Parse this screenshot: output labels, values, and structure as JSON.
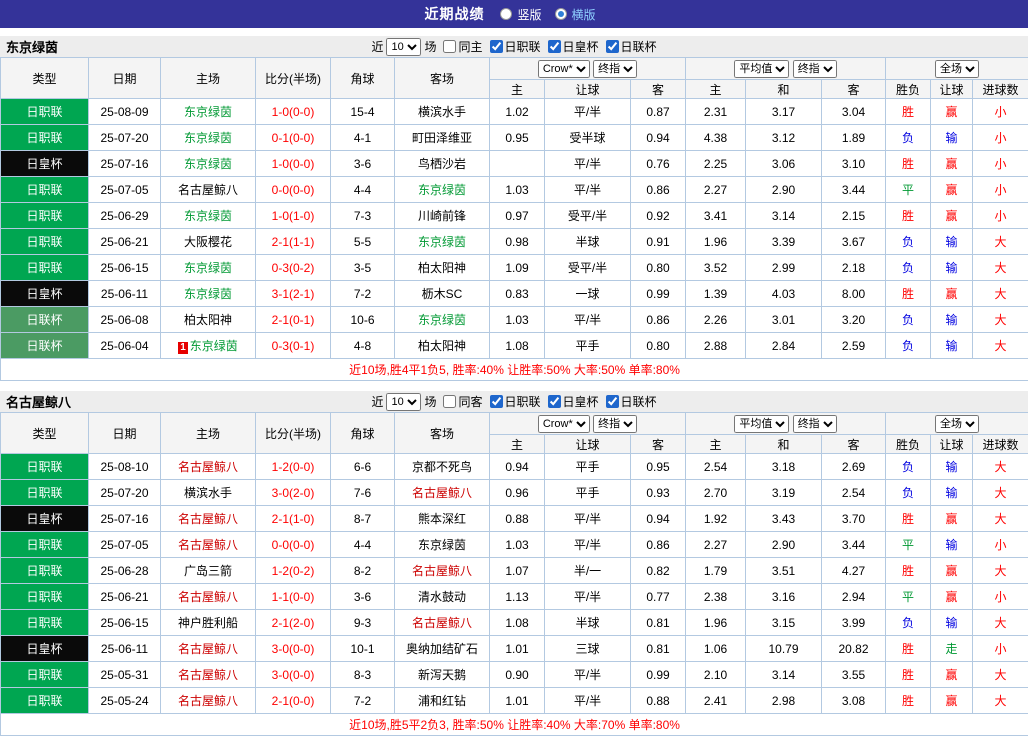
{
  "topbar": {
    "title": "近期战绩",
    "radio_vertical": "竖版",
    "radio_horizontal": "横版"
  },
  "controls": {
    "near_label": "近",
    "games_count": "10",
    "games_label": "场",
    "leagues": [
      "日职联",
      "日皇杯",
      "日联杯"
    ]
  },
  "header_selects": {
    "bookmaker": "Crow*",
    "final_odds": "终指",
    "average": "平均值",
    "final_odds2": "终指",
    "fulltime": "全场"
  },
  "table_headers": {
    "type": "类型",
    "date": "日期",
    "home": "主场",
    "score": "比分(半场)",
    "corners": "角球",
    "away": "客场",
    "odds_home": "主",
    "odds_line": "让球",
    "odds_away": "客",
    "euro_home": "主",
    "euro_draw": "和",
    "euro_away": "客",
    "result_outcome": "胜负",
    "result_handicap": "让球",
    "result_goals": "进球数"
  },
  "type_colors": {
    "日职联": "#00A651",
    "日皇杯": "#0A0A0A",
    "日联杯": "#4B9B63"
  },
  "result_colors": {
    "胜": "#FF0000",
    "平": "#009933",
    "负": "#0000E0",
    "赢": "#FF0000",
    "输": "#0000E0",
    "走": "#009933",
    "大": "#FF0000",
    "小": "#FF0000"
  },
  "sections": [
    {
      "team": "东京绿茵",
      "team_color": "#009933",
      "same_label": "同主",
      "summary": "近10场,胜4平1负5, 胜率:40% 让胜率:50% 大率:50% 单率:80%",
      "rows": [
        {
          "type": "日职联",
          "date": "25-08-09",
          "home": "东京绿茵",
          "hf": true,
          "score": "1-0(0-0)",
          "corners": "15-4",
          "away": "横滨水手",
          "af": false,
          "o1": "1.02",
          "hcp": "平/半",
          "o2": "0.87",
          "e1": "2.31",
          "e2": "3.17",
          "e3": "3.04",
          "r1": "胜",
          "r2": "赢",
          "r3": "小"
        },
        {
          "type": "日职联",
          "date": "25-07-20",
          "home": "东京绿茵",
          "hf": true,
          "score": "0-1(0-0)",
          "corners": "4-1",
          "away": "町田泽维亚",
          "af": false,
          "o1": "0.95",
          "hcp": "受半球",
          "o2": "0.94",
          "e1": "4.38",
          "e2": "3.12",
          "e3": "1.89",
          "r1": "负",
          "r2": "输",
          "r3": "小"
        },
        {
          "type": "日皇杯",
          "date": "25-07-16",
          "home": "东京绿茵",
          "hf": true,
          "score": "1-0(0-0)",
          "corners": "3-6",
          "away": "鸟栖沙岩",
          "af": false,
          "o1": "",
          "hcp": "平/半",
          "o2": "0.76",
          "e1": "2.25",
          "e2": "3.06",
          "e3": "3.10",
          "r1": "胜",
          "r2": "赢",
          "r3": "小"
        },
        {
          "type": "日职联",
          "date": "25-07-05",
          "home": "名古屋鲸八",
          "hf": false,
          "score": "0-0(0-0)",
          "corners": "4-4",
          "away": "东京绿茵",
          "af": true,
          "o1": "1.03",
          "hcp": "平/半",
          "o2": "0.86",
          "e1": "2.27",
          "e2": "2.90",
          "e3": "3.44",
          "r1": "平",
          "r2": "赢",
          "r3": "小"
        },
        {
          "type": "日职联",
          "date": "25-06-29",
          "home": "东京绿茵",
          "hf": true,
          "score": "1-0(1-0)",
          "corners": "7-3",
          "away": "川崎前锋",
          "af": false,
          "o1": "0.97",
          "hcp": "受平/半",
          "o2": "0.92",
          "e1": "3.41",
          "e2": "3.14",
          "e3": "2.15",
          "r1": "胜",
          "r2": "赢",
          "r3": "小"
        },
        {
          "type": "日职联",
          "date": "25-06-21",
          "home": "大阪樱花",
          "hf": false,
          "score": "2-1(1-1)",
          "corners": "5-5",
          "away": "东京绿茵",
          "af": true,
          "o1": "0.98",
          "hcp": "半球",
          "o2": "0.91",
          "e1": "1.96",
          "e2": "3.39",
          "e3": "3.67",
          "r1": "负",
          "r2": "输",
          "r3": "大"
        },
        {
          "type": "日职联",
          "date": "25-06-15",
          "home": "东京绿茵",
          "hf": true,
          "score": "0-3(0-2)",
          "corners": "3-5",
          "away": "柏太阳神",
          "af": false,
          "o1": "1.09",
          "hcp": "受平/半",
          "o2": "0.80",
          "e1": "3.52",
          "e2": "2.99",
          "e3": "2.18",
          "r1": "负",
          "r2": "输",
          "r3": "大"
        },
        {
          "type": "日皇杯",
          "date": "25-06-11",
          "home": "东京绿茵",
          "hf": true,
          "score": "3-1(2-1)",
          "corners": "7-2",
          "away": "枥木SC",
          "af": false,
          "o1": "0.83",
          "hcp": "一球",
          "o2": "0.99",
          "e1": "1.39",
          "e2": "4.03",
          "e3": "8.00",
          "r1": "胜",
          "r2": "赢",
          "r3": "大"
        },
        {
          "type": "日联杯",
          "date": "25-06-08",
          "home": "柏太阳神",
          "hf": false,
          "score": "2-1(0-1)",
          "corners": "10-6",
          "away": "东京绿茵",
          "af": true,
          "o1": "1.03",
          "hcp": "平/半",
          "o2": "0.86",
          "e1": "2.26",
          "e2": "3.01",
          "e3": "3.20",
          "r1": "负",
          "r2": "输",
          "r3": "大"
        },
        {
          "type": "日联杯",
          "date": "25-06-04",
          "home": "东京绿茵",
          "hf": true,
          "badge": "1",
          "score": "0-3(0-1)",
          "corners": "4-8",
          "away": "柏太阳神",
          "af": false,
          "o1": "1.08",
          "hcp": "平手",
          "o2": "0.80",
          "e1": "2.88",
          "e2": "2.84",
          "e3": "2.59",
          "r1": "负",
          "r2": "输",
          "r3": "大"
        }
      ]
    },
    {
      "team": "名古屋鲸八",
      "team_color": "#CC0000",
      "same_label": "同客",
      "summary": "近10场,胜5平2负3, 胜率:50% 让胜率:40% 大率:70% 单率:80%",
      "rows": [
        {
          "type": "日职联",
          "date": "25-08-10",
          "home": "名古屋鲸八",
          "hf": true,
          "score": "1-2(0-0)",
          "corners": "6-6",
          "away": "京都不死鸟",
          "af": false,
          "o1": "0.94",
          "hcp": "平手",
          "o2": "0.95",
          "e1": "2.54",
          "e2": "3.18",
          "e3": "2.69",
          "r1": "负",
          "r2": "输",
          "r3": "大"
        },
        {
          "type": "日职联",
          "date": "25-07-20",
          "home": "横滨水手",
          "hf": false,
          "score": "3-0(2-0)",
          "corners": "7-6",
          "away": "名古屋鲸八",
          "af": true,
          "o1": "0.96",
          "hcp": "平手",
          "o2": "0.93",
          "e1": "2.70",
          "e2": "3.19",
          "e3": "2.54",
          "r1": "负",
          "r2": "输",
          "r3": "大"
        },
        {
          "type": "日皇杯",
          "date": "25-07-16",
          "home": "名古屋鲸八",
          "hf": true,
          "score": "2-1(1-0)",
          "corners": "8-7",
          "away": "熊本深红",
          "af": false,
          "o1": "0.88",
          "hcp": "平/半",
          "o2": "0.94",
          "e1": "1.92",
          "e2": "3.43",
          "e3": "3.70",
          "r1": "胜",
          "r2": "赢",
          "r3": "大"
        },
        {
          "type": "日职联",
          "date": "25-07-05",
          "home": "名古屋鲸八",
          "hf": true,
          "score": "0-0(0-0)",
          "corners": "4-4",
          "away": "东京绿茵",
          "af": false,
          "o1": "1.03",
          "hcp": "平/半",
          "o2": "0.86",
          "e1": "2.27",
          "e2": "2.90",
          "e3": "3.44",
          "r1": "平",
          "r2": "输",
          "r3": "小"
        },
        {
          "type": "日职联",
          "date": "25-06-28",
          "home": "广岛三箭",
          "hf": false,
          "score": "1-2(0-2)",
          "corners": "8-2",
          "away": "名古屋鲸八",
          "af": true,
          "o1": "1.07",
          "hcp": "半/一",
          "o2": "0.82",
          "e1": "1.79",
          "e2": "3.51",
          "e3": "4.27",
          "r1": "胜",
          "r2": "赢",
          "r3": "大"
        },
        {
          "type": "日职联",
          "date": "25-06-21",
          "home": "名古屋鲸八",
          "hf": true,
          "score": "1-1(0-0)",
          "corners": "3-6",
          "away": "清水鼓动",
          "af": false,
          "o1": "1.13",
          "hcp": "平/半",
          "o2": "0.77",
          "e1": "2.38",
          "e2": "3.16",
          "e3": "2.94",
          "r1": "平",
          "r2": "赢",
          "r3": "小"
        },
        {
          "type": "日职联",
          "date": "25-06-15",
          "home": "神户胜利船",
          "hf": false,
          "score": "2-1(2-0)",
          "corners": "9-3",
          "away": "名古屋鲸八",
          "af": true,
          "o1": "1.08",
          "hcp": "半球",
          "o2": "0.81",
          "e1": "1.96",
          "e2": "3.15",
          "e3": "3.99",
          "r1": "负",
          "r2": "输",
          "r3": "大"
        },
        {
          "type": "日皇杯",
          "date": "25-06-11",
          "home": "名古屋鲸八",
          "hf": true,
          "score": "3-0(0-0)",
          "corners": "10-1",
          "away": "奥纳加结矿石",
          "af": false,
          "o1": "1.01",
          "hcp": "三球",
          "o2": "0.81",
          "e1": "1.06",
          "e2": "10.79",
          "e3": "20.82",
          "r1": "胜",
          "r2": "走",
          "r3": "小"
        },
        {
          "type": "日职联",
          "date": "25-05-31",
          "home": "名古屋鲸八",
          "hf": true,
          "score": "3-0(0-0)",
          "corners": "8-3",
          "away": "新泻天鹅",
          "af": false,
          "o1": "0.90",
          "hcp": "平/半",
          "o2": "0.99",
          "e1": "2.10",
          "e2": "3.14",
          "e3": "3.55",
          "r1": "胜",
          "r2": "赢",
          "r3": "大"
        },
        {
          "type": "日职联",
          "date": "25-05-24",
          "home": "名古屋鲸八",
          "hf": true,
          "score": "2-1(0-0)",
          "corners": "7-2",
          "away": "浦和红钻",
          "af": false,
          "o1": "1.01",
          "hcp": "平/半",
          "o2": "0.88",
          "e1": "2.41",
          "e2": "2.98",
          "e3": "3.08",
          "r1": "胜",
          "r2": "赢",
          "r3": "大"
        }
      ]
    }
  ]
}
